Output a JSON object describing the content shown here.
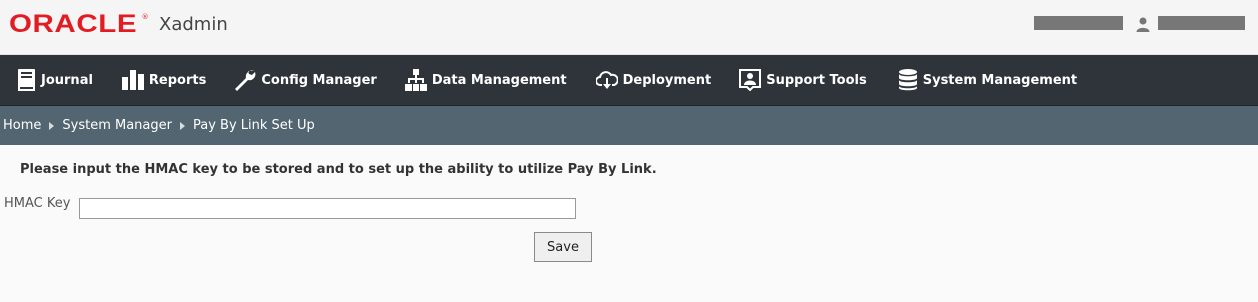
{
  "header": {
    "brand": "ORACLE",
    "brand_mark": "®",
    "app_name": "Xadmin"
  },
  "nav": {
    "items": [
      {
        "label": "Journal",
        "icon": "journal-icon"
      },
      {
        "label": "Reports",
        "icon": "reports-icon"
      },
      {
        "label": "Config Manager",
        "icon": "wrench-icon"
      },
      {
        "label": "Data Management",
        "icon": "hierarchy-icon"
      },
      {
        "label": "Deployment",
        "icon": "cloud-download-icon"
      },
      {
        "label": "Support Tools",
        "icon": "support-icon"
      },
      {
        "label": "System Management",
        "icon": "database-icon"
      }
    ]
  },
  "breadcrumb": {
    "items": [
      "Home",
      "System Manager",
      "Pay By Link Set Up"
    ]
  },
  "form": {
    "instruction": "Please input the HMAC key to be stored and to set up the ability to utilize Pay By Link.",
    "hmac_label": "HMAC Key",
    "hmac_value": "",
    "save_label": "Save"
  },
  "colors": {
    "brand_red": "#e21c23",
    "nav_bg": "#2e343a",
    "breadcrumb_bg": "#536571"
  }
}
